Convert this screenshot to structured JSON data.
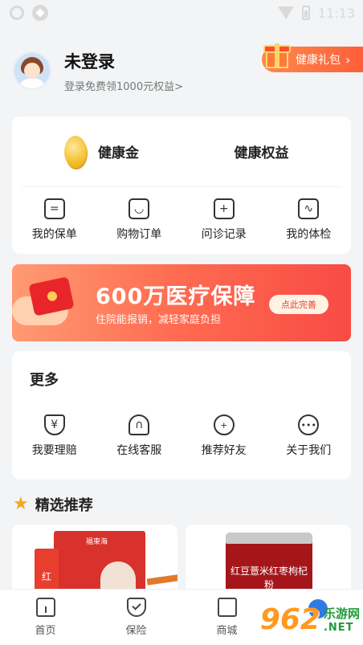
{
  "status_bar": {
    "time": "11:13"
  },
  "profile": {
    "name": "未登录",
    "subtitle": "登录免费领1000元权益>",
    "gift_label": "健康礼包"
  },
  "wallet": {
    "coin_label": "健康金",
    "rights_label": "健康权益"
  },
  "quick_links": [
    {
      "label": "我的保单"
    },
    {
      "label": "购物订单"
    },
    {
      "label": "问诊记录"
    },
    {
      "label": "我的体检"
    }
  ],
  "banner": {
    "title": "600万医疗保障",
    "subtitle": "住院能报销，减轻家庭负担",
    "button": "点此完善"
  },
  "more": {
    "title": "更多",
    "items": [
      {
        "label": "我要理赔"
      },
      {
        "label": "在线客服"
      },
      {
        "label": "推荐好友"
      },
      {
        "label": "关于我们"
      }
    ]
  },
  "recommend": {
    "title": "精选推荐",
    "product1_brand": "福東海",
    "product1_stick": "红",
    "product2_text": "红豆薏米红枣枸杞粉"
  },
  "tabs": [
    {
      "label": "首页"
    },
    {
      "label": "保险"
    },
    {
      "label": "商城"
    }
  ],
  "watermark": {
    "number": "962",
    "cn": "乐游网",
    "en": ".NET"
  }
}
